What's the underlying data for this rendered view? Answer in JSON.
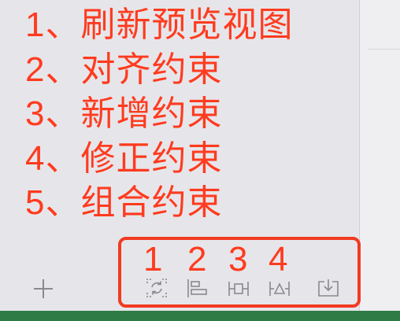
{
  "annotations": [
    "1、刷新预览视图",
    "2、对齐约束",
    "3、新增约束",
    "4、修正约束",
    "5、组合约束"
  ],
  "toolbar_numbers": [
    "1",
    "2",
    "3",
    "4"
  ],
  "toolbar_icons": [
    "refresh-preview-icon",
    "align-constraints-icon",
    "add-constraints-icon",
    "resolve-constraints-icon",
    "embed-constraints-icon"
  ],
  "colors": {
    "annotation_red": "#ff3b1f",
    "highlight_border": "#f23a22",
    "icon_gray": "#8a8a8e",
    "panel_bg": "#e6e6ea",
    "bottom_strip": "#2e7b46"
  }
}
